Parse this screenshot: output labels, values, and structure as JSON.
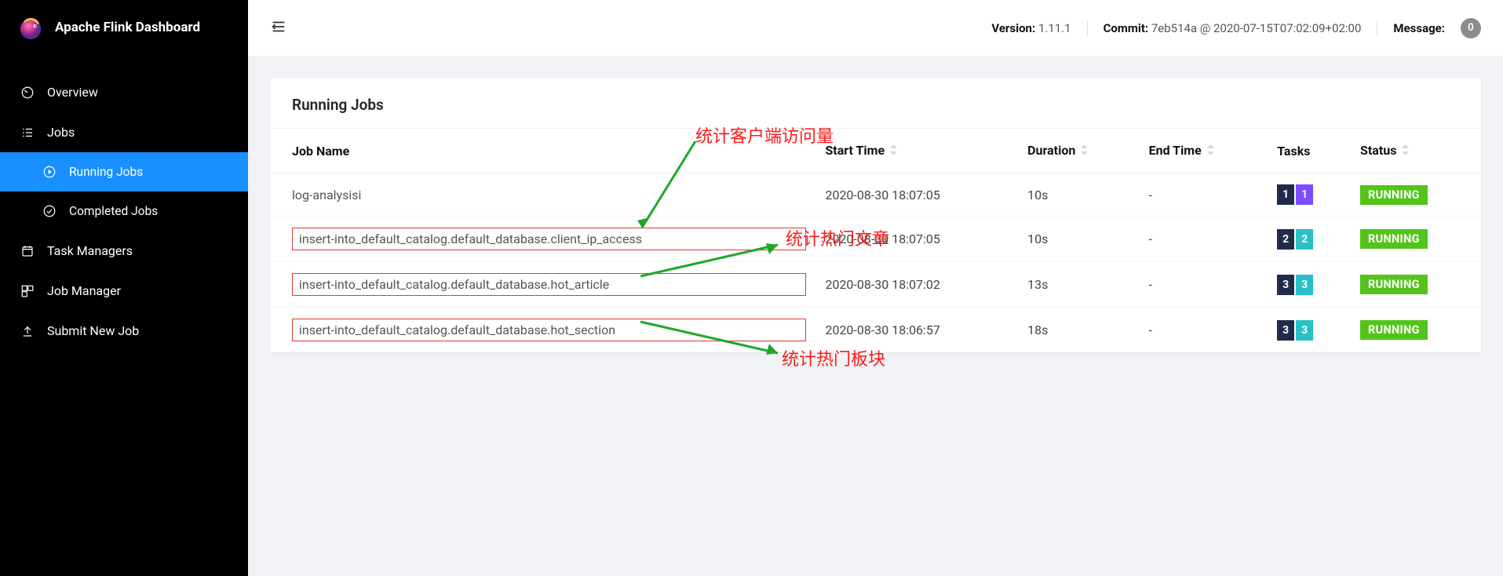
{
  "brand": {
    "title": "Apache Flink Dashboard"
  },
  "sidebar": {
    "overview": "Overview",
    "jobs": "Jobs",
    "running_jobs": "Running Jobs",
    "completed_jobs": "Completed Jobs",
    "task_managers": "Task Managers",
    "job_manager": "Job Manager",
    "submit_new_job": "Submit New Job"
  },
  "header": {
    "version_label": "Version:",
    "version_value": "1.11.1",
    "commit_label": "Commit:",
    "commit_value": "7eb514a @ 2020-07-15T07:02:09+02:00",
    "message_label": "Message:",
    "message_count": "0"
  },
  "card": {
    "title": "Running Jobs"
  },
  "columns": {
    "job_name": "Job Name",
    "start_time": "Start Time",
    "duration": "Duration",
    "end_time": "End Time",
    "tasks": "Tasks",
    "status": "Status"
  },
  "rows": [
    {
      "name": "log-analysisi",
      "start": "2020-08-30 18:07:05",
      "dur": "10s",
      "end": "-",
      "t1": "1",
      "t2": "1",
      "t2c": "purple",
      "status": "RUNNING",
      "boxed": false
    },
    {
      "name": "insert-into_default_catalog.default_database.client_ip_access",
      "start": "2020-08-30 18:07:05",
      "dur": "10s",
      "end": "-",
      "t1": "2",
      "t2": "2",
      "t2c": "cyan",
      "status": "RUNNING",
      "boxed": true
    },
    {
      "name": "insert-into_default_catalog.default_database.hot_article",
      "start": "2020-08-30 18:07:02",
      "dur": "13s",
      "end": "-",
      "t1": "3",
      "t2": "3",
      "t2c": "cyan",
      "status": "RUNNING",
      "boxed": true
    },
    {
      "name": "insert-into_default_catalog.default_database.hot_section",
      "start": "2020-08-30 18:06:57",
      "dur": "18s",
      "end": "-",
      "t1": "3",
      "t2": "3",
      "t2c": "cyan",
      "status": "RUNNING",
      "boxed": true
    }
  ],
  "annotations": {
    "a1": "统计客户端访问量",
    "a2": "统计热门文章",
    "a3": "统计热门板块"
  }
}
